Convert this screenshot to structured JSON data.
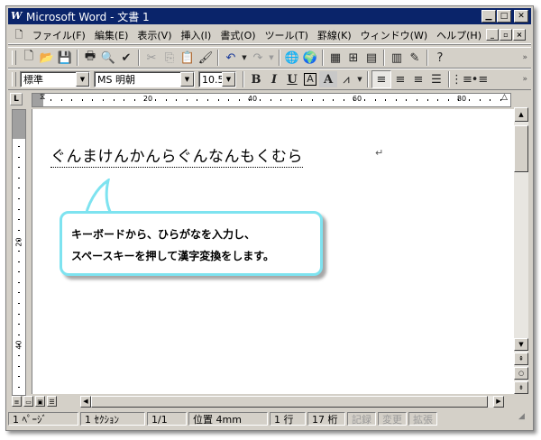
{
  "window": {
    "title": "Microsoft Word - 文書 1",
    "app_icon": "W",
    "buttons": [
      "minimize",
      "maximize",
      "close"
    ]
  },
  "menubar": {
    "items": [
      "ファイル(F)",
      "編集(E)",
      "表示(V)",
      "挿入(I)",
      "書式(O)",
      "ツール(T)",
      "罫線(K)",
      "ウィンドウ(W)",
      "ヘルプ(H)"
    ]
  },
  "toolbar_standard": {
    "icons": [
      "new-document-icon",
      "open-folder-icon",
      "save-icon",
      "print-icon",
      "print-preview-icon",
      "spelling-icon",
      "cut-icon",
      "copy-icon",
      "paste-icon",
      "format-painter-icon",
      "undo-icon",
      "redo-icon",
      "insert-hyperlink-icon",
      "web-toolbar-icon",
      "tables-borders-icon",
      "insert-table-icon",
      "insert-excel-icon",
      "columns-icon",
      "drawing-icon",
      "help-icon"
    ]
  },
  "toolbar_formatting": {
    "style": "標準",
    "font": "MS 明朝",
    "font_size": "10.5",
    "bold": "B",
    "italic": "I",
    "underline": "U",
    "char_border": "A",
    "char_shading": "A"
  },
  "ruler": {
    "numbers": [
      "20",
      "40",
      "60",
      "80"
    ],
    "tab_corner": "L"
  },
  "vruler": {
    "numbers": [
      "20",
      "40"
    ]
  },
  "document": {
    "text": "ぐんまけんかんらぐんなんもくむら",
    "paragraph_mark": "↵"
  },
  "callout": {
    "line1": "キーボードから、ひらがなを入力し、",
    "line2": "スペースキーを押して漢字変換をします。",
    "border_color": "#7ee3f0"
  },
  "statusbar": {
    "page": "1 ﾍﾟｰｼﾞ",
    "section": "1 ｾｸｼｮﾝ",
    "page_of": "1/1",
    "position": "位置 4mm",
    "line": "1 行",
    "column": "17 桁",
    "rec": "記録",
    "trk": "変更",
    "ext": "拡張"
  },
  "colors": {
    "titlebar": "#0a246a",
    "face": "#d4d0c8"
  }
}
